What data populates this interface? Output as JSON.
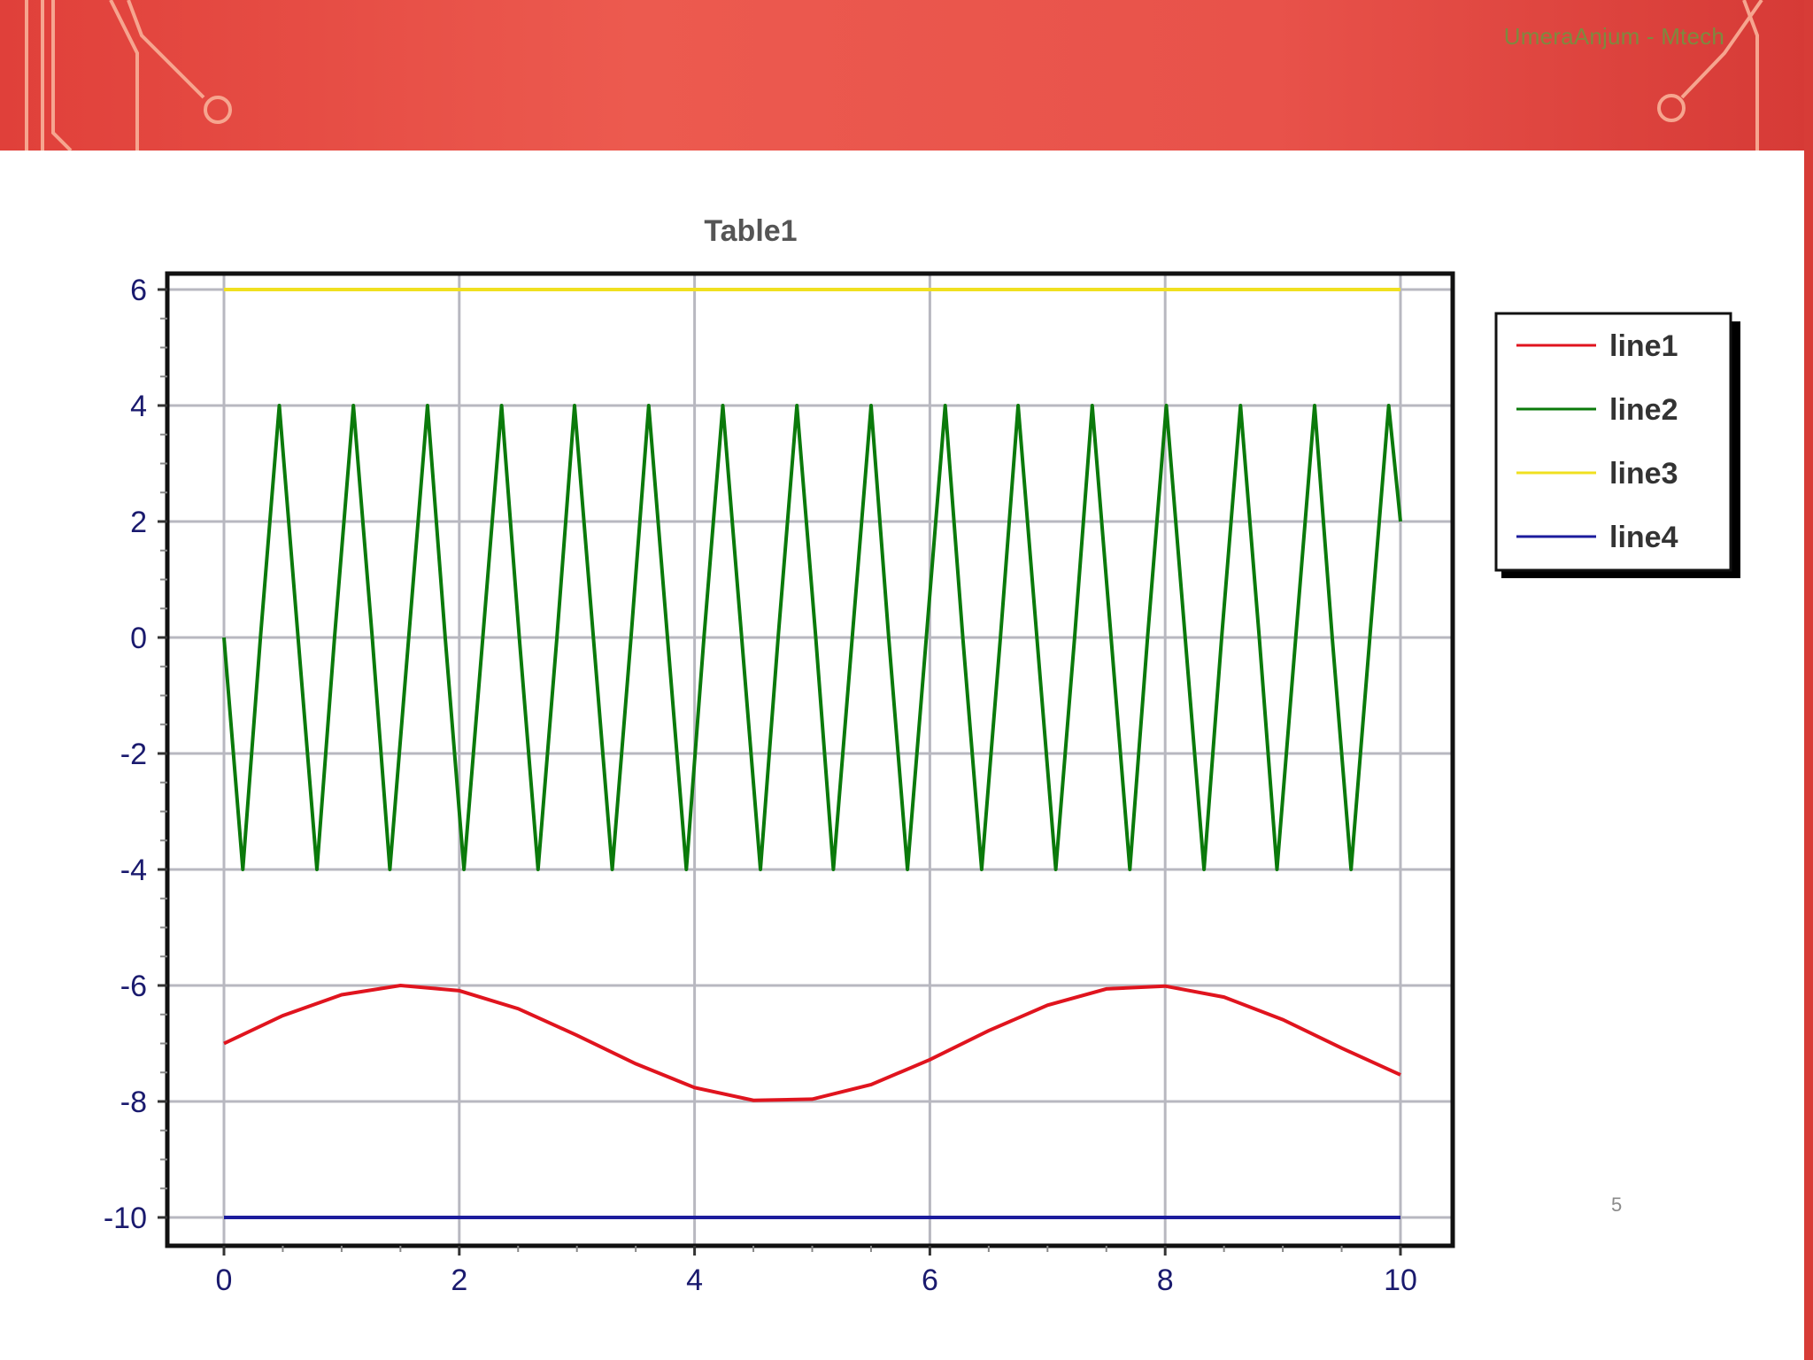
{
  "slide": {
    "author": "UmeraAnjum - Mtech",
    "page_number": "5",
    "banner_color": "#e8524a",
    "banner_art_color": "#f6a58f"
  },
  "chart_data": {
    "type": "line",
    "title": "Table1",
    "xlabel": "",
    "ylabel": "",
    "xlim": [
      0,
      10
    ],
    "ylim": [
      -10,
      6
    ],
    "x_ticks": [
      "0",
      "2",
      "4",
      "6",
      "8",
      "10"
    ],
    "y_ticks": [
      "6",
      "4",
      "2",
      "0",
      "-2",
      "-4",
      "-6",
      "-8",
      "-10"
    ],
    "grid": true,
    "legend_position": "right",
    "series": [
      {
        "name": "line1",
        "color": "#e0141e",
        "x": [
          0,
          0.5,
          1,
          1.5,
          2,
          2.5,
          3,
          3.5,
          4,
          4.5,
          5,
          5.5,
          6,
          6.5,
          7,
          7.5,
          8,
          8.5,
          9,
          9.5,
          10
        ],
        "y": [
          -7.0,
          -6.52,
          -6.16,
          -6.0,
          -6.09,
          -6.4,
          -6.86,
          -7.35,
          -7.76,
          -7.98,
          -7.96,
          -7.71,
          -7.28,
          -6.78,
          -6.34,
          -6.06,
          -6.01,
          -6.2,
          -6.59,
          -7.08,
          -7.54
        ]
      },
      {
        "name": "line2",
        "color": "#0b7a0b",
        "x": [
          0,
          0.16,
          0.31,
          0.47,
          0.63,
          0.79,
          0.94,
          1.1,
          1.26,
          1.41,
          1.57,
          1.73,
          1.88,
          2.04,
          2.2,
          2.36,
          2.51,
          2.67,
          2.83,
          2.98,
          3.14,
          3.3,
          3.46,
          3.61,
          3.77,
          3.93,
          4.08,
          4.24,
          4.4,
          4.56,
          4.71,
          4.87,
          5.03,
          5.18,
          5.34,
          5.5,
          5.65,
          5.81,
          5.97,
          6.13,
          6.28,
          6.44,
          6.6,
          6.75,
          6.91,
          7.07,
          7.23,
          7.38,
          7.54,
          7.7,
          7.85,
          8.01,
          8.17,
          8.33,
          8.48,
          8.64,
          8.8,
          8.95,
          9.11,
          9.27,
          9.42,
          9.58,
          9.74,
          9.9,
          10
        ],
        "y": [
          0,
          -4,
          0,
          4,
          0,
          -4,
          0,
          4,
          0,
          -4,
          0,
          4,
          0,
          -4,
          0,
          4,
          0,
          -4,
          0,
          4,
          0,
          -4,
          0,
          4,
          0,
          -4,
          0,
          4,
          0,
          -4,
          0,
          4,
          0,
          -4,
          0,
          4,
          0,
          -4,
          0,
          4,
          0,
          -4,
          0,
          4,
          0,
          -4,
          0,
          4,
          0,
          -4,
          0,
          4,
          0,
          -4,
          0,
          4,
          0,
          -4,
          0,
          4,
          0,
          -4,
          0,
          4,
          2
        ]
      },
      {
        "name": "line3",
        "color": "#f0e020",
        "x": [
          0,
          10
        ],
        "y": [
          6,
          6
        ]
      },
      {
        "name": "line4",
        "color": "#1c1c9c",
        "x": [
          0,
          10
        ],
        "y": [
          -10,
          -10
        ]
      }
    ]
  }
}
